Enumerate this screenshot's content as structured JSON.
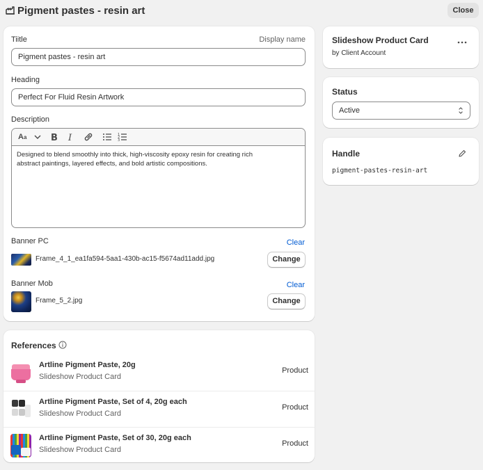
{
  "page": {
    "title": "Pigment pastes - resin art",
    "close_label": "Close"
  },
  "form": {
    "title_label": "Tiitle",
    "display_name_label": "Display name",
    "title_value": "Pigment pastes - resin art",
    "heading_label": "Heading",
    "heading_value": "Perfect For Fluid Resin Artwork",
    "description_label": "Description",
    "description_text_line1": "Designed to blend smoothly into thick, high-viscosity epoxy resin for creating rich",
    "description_text_line2": "abstract paintings, layered effects, and bold artistic compositions.",
    "toolbar": [
      "font-size-icon",
      "chevron-down-icon",
      "bold-icon",
      "italic-icon",
      "link-icon",
      "bullet-list-icon",
      "numbered-list-icon"
    ],
    "banner_pc_label": "Banner PC",
    "banner_pc_clear": "Clear",
    "banner_pc_file": "Frame_4_1_ea1fa594-5aa1-430b-ac15-f5674ad11add.jpg",
    "banner_pc_change": "Change",
    "banner_mob_label": "Banner Mob",
    "banner_mob_clear": "Clear",
    "banner_mob_file": "Frame_5_2.jpg",
    "banner_mob_change": "Change"
  },
  "references": {
    "title": "References",
    "items": [
      {
        "name": "Artline Pigment Paste, 20g",
        "sub": "Slideshow Product Card",
        "type": "Product"
      },
      {
        "name": "Artline Pigment Paste, Set of 4, 20g each",
        "sub": "Slideshow Product Card",
        "type": "Product"
      },
      {
        "name": "Artline Pigment Paste, Set of 30, 20g each",
        "sub": "Slideshow Product Card",
        "type": "Product"
      }
    ]
  },
  "sidebar": {
    "definition_name": "Slideshow Product Card",
    "definition_by": "by Client Account",
    "status_label": "Status",
    "status_value": "Active",
    "handle_label": "Handle",
    "handle_value": "pigment-pastes-resin-art"
  },
  "colors": {
    "link": "#005bd3",
    "background": "#f1f1f1",
    "card": "#ffffff"
  }
}
